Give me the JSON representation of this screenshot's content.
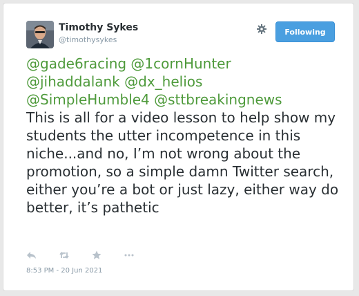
{
  "user": {
    "name": "Timothy Sykes",
    "handle": "@timothysykes"
  },
  "follow_button": {
    "label": "Following"
  },
  "tweet": {
    "mentions_line1": "@gade6racing @1cornHunter",
    "mentions_line2": "@jihaddalank @dx_helios",
    "mentions_line3a": "@SimpleHumble4",
    "mentions_line3b": "@sttbreakingnews",
    "body": "This is all for a video lesson to help show my students the utter incompetence in this niche...and no, I’m not wrong about the promotion, so a simple damn Twitter search, either you’re a bot or just lazy, either way do better, it’s pathetic"
  },
  "actions": [
    "reply-icon",
    "retweet-icon",
    "favorite-icon",
    "more-icon"
  ],
  "timestamp": "8:53 PM - 20 Jun 2021",
  "colors": {
    "mention": "#4e9a3b",
    "button": "#4a9fe0",
    "text": "#292f33",
    "muted": "#8899a6"
  }
}
